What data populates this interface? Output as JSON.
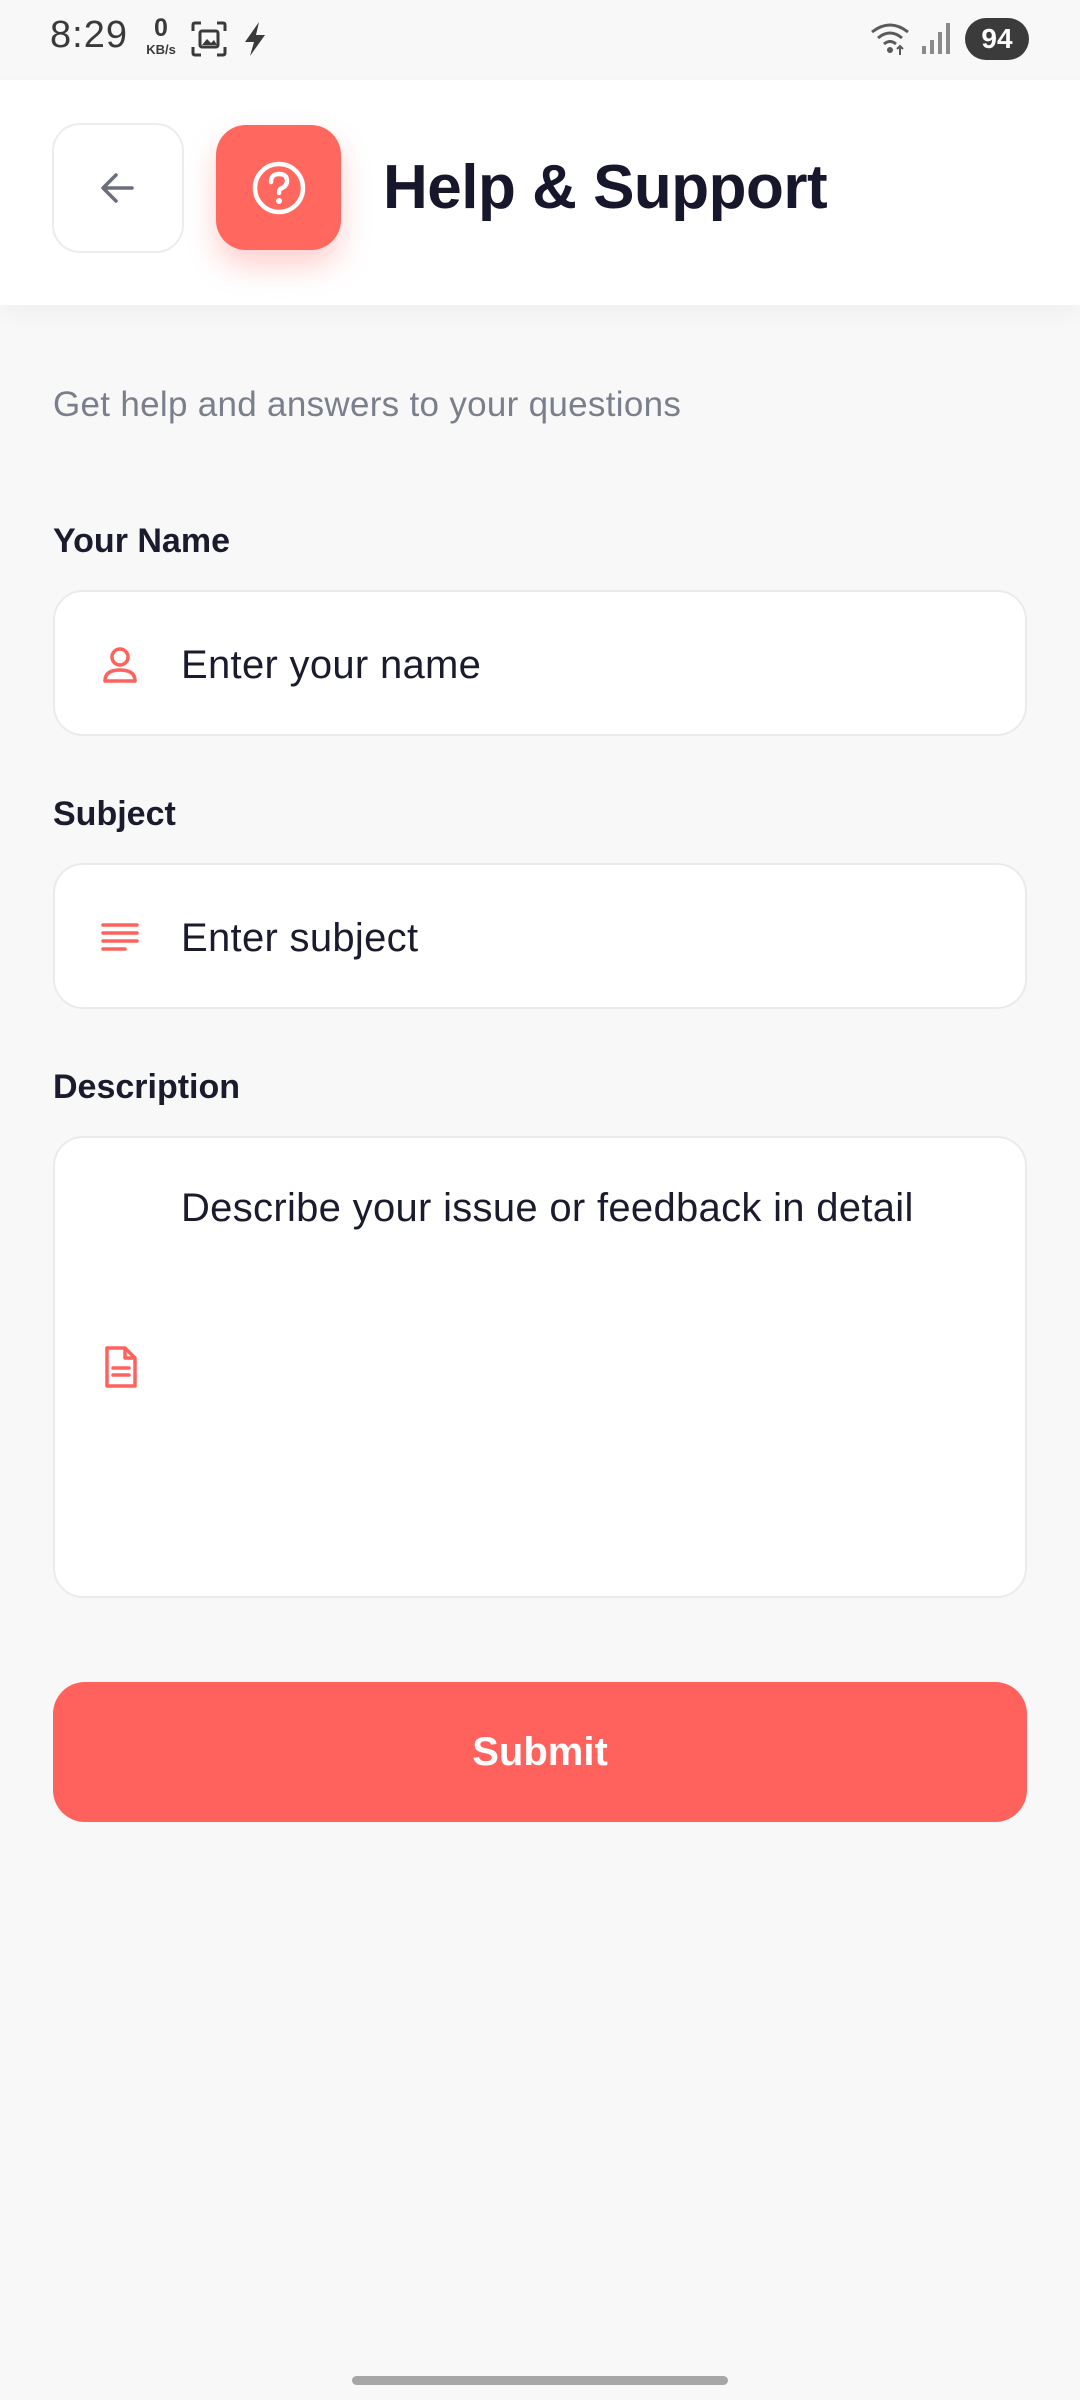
{
  "status_bar": {
    "time": "8:29",
    "net_speed_value": "0",
    "net_speed_unit": "KB/s",
    "battery": "94",
    "icons": [
      "screenshot-icon",
      "flash-icon",
      "wifi-icon",
      "signal-icon"
    ]
  },
  "header": {
    "title": "Help & Support",
    "back_icon": "arrow-left-icon",
    "badge_icon": "help-circle-icon"
  },
  "page": {
    "subtitle": "Get help and answers to your questions"
  },
  "form": {
    "name": {
      "label": "Your Name",
      "placeholder": "Enter your name",
      "icon": "user-icon"
    },
    "subject": {
      "label": "Subject",
      "placeholder": "Enter subject",
      "icon": "lines-icon"
    },
    "description": {
      "label": "Description",
      "placeholder": "Describe your issue or feedback in detail",
      "icon": "document-icon"
    },
    "submit_label": "Submit"
  },
  "colors": {
    "accent": "#ff625c",
    "title": "#17172b",
    "subtitle": "#7a7f8c",
    "background": "#f8f8f9"
  }
}
